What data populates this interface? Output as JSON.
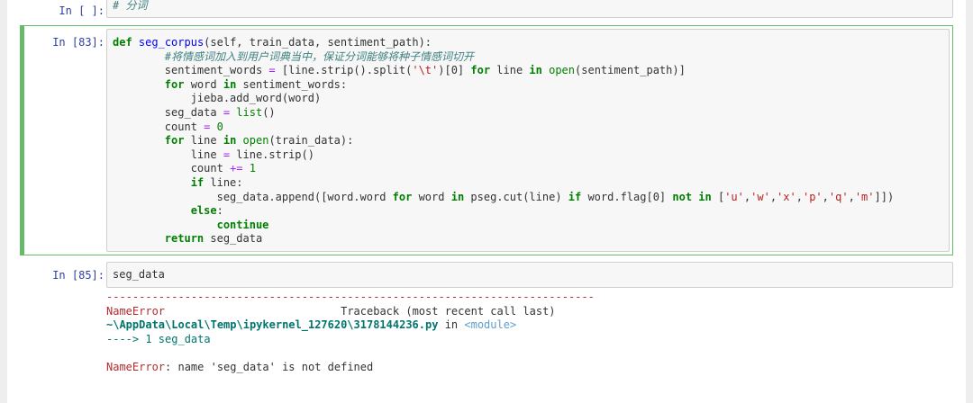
{
  "cell_top": {
    "prompt": "In  [ ]:",
    "code": "# 分词"
  },
  "cell_main": {
    "prompt": "In  [83]:",
    "lines": {
      "l1_def": "def",
      "l1_fn": "seg_corpus",
      "l1_rest": "(self, train_data, sentiment_path):",
      "l2_comment": "#将情感词加入到用户词典当中，保证分词能够将种子情感词切开",
      "l3_a": "sentiment_words ",
      "l3_eq": "=",
      "l3_b": " [line.strip().split(",
      "l3_str": "'\\t'",
      "l3_c": ")[0] ",
      "l3_for": "for",
      "l3_d": " line ",
      "l3_in": "in",
      "l3_open": "open",
      "l3_e": "(sentiment_path)]",
      "l4_for": "for",
      "l4_a": " word ",
      "l4_in": "in",
      "l4_b": " sentiment_words:",
      "l5": "jieba.add_word(word)",
      "l6_a": "seg_data ",
      "l6_eq": "=",
      "l6_list": "list",
      "l6_b": "()",
      "l7_a": "count ",
      "l7_eq": "=",
      "l7_num": "0",
      "l8_for": "for",
      "l8_a": " line ",
      "l8_in": "in",
      "l8_open": "open",
      "l8_b": "(train_data):",
      "l9_a": "line ",
      "l9_eq": "=",
      "l9_b": " line.strip()",
      "l10_a": "count ",
      "l10_eq": "+=",
      "l10_num": "1",
      "l11_if": "if",
      "l11_a": " line:",
      "l12_a": "seg_data.append([word.word ",
      "l12_for": "for",
      "l12_b": " word ",
      "l12_in": "in",
      "l12_c": " pseg.cut(line) ",
      "l12_if": "if",
      "l12_d": " word.flag[0] ",
      "l12_not": "not",
      "l12_in2": "in",
      "l12_e": " [",
      "l12_s1": "'u'",
      "l12_s2": "'w'",
      "l12_s3": "'x'",
      "l12_s4": "'p'",
      "l12_s5": "'q'",
      "l12_s6": "'m'",
      "l12_f": "]])",
      "l13_else": "else",
      "l13_colon": ":",
      "l14_continue": "continue",
      "l15_return": "return",
      "l15_a": " seg_data"
    }
  },
  "cell_run": {
    "prompt": "In  [85]:",
    "code": "seg_data"
  },
  "traceback": {
    "separator": "---------------------------------------------------------------------------",
    "error_name": "NameError",
    "traceback_label": "Traceback (most recent call last)",
    "path": "~\\AppData\\Local\\Temp\\ipykernel_127620\\3178144236.py",
    "in_word": " in ",
    "module": "<module>",
    "arrow": "----> 1 seg_data",
    "final_name": "NameError",
    "final_msg": ": name 'seg_data' is not defined"
  }
}
